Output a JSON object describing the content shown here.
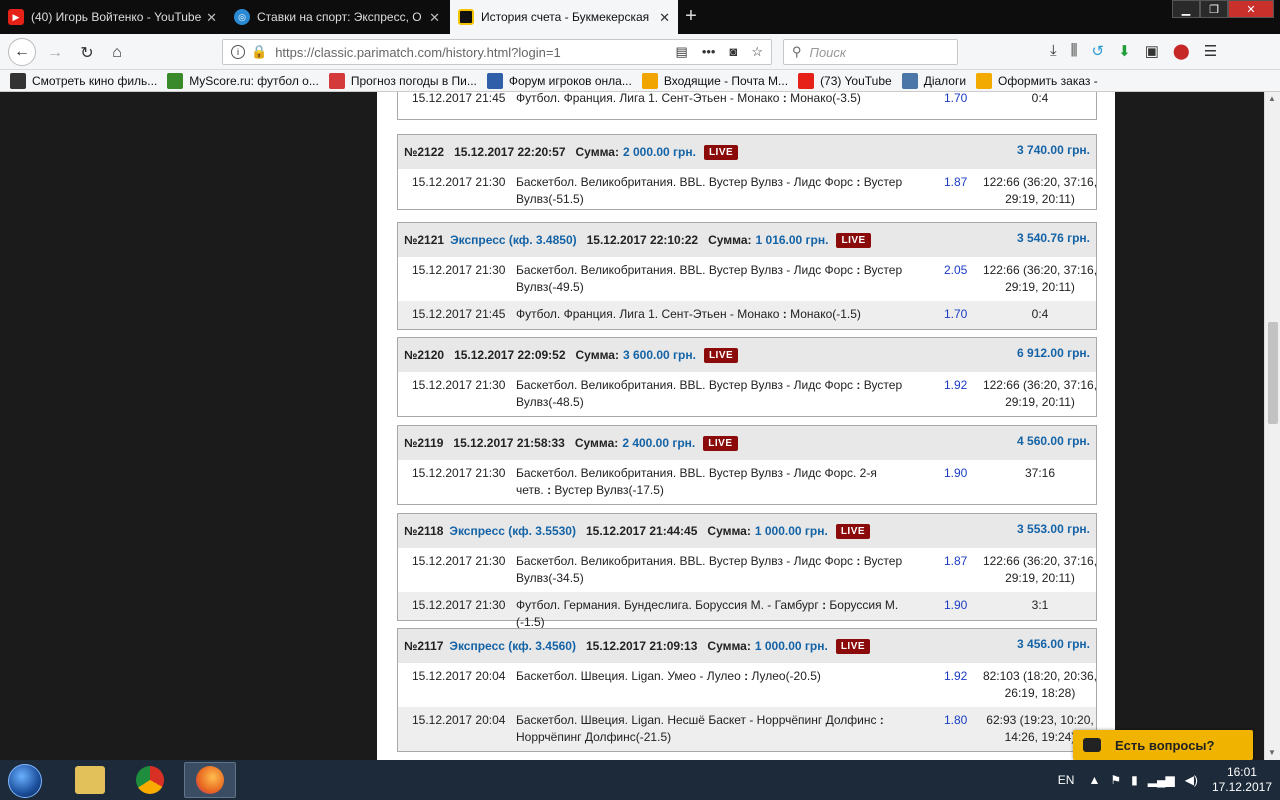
{
  "browser": {
    "tabs": [
      {
        "title": "(40) Игорь Войтенко - YouTube",
        "icon": "youtube-icon",
        "color": "#e62117",
        "active": false
      },
      {
        "title": "Ставки на спорт: Экспресс, О",
        "icon": "parimatch-favicon",
        "color": "#2a8ad4",
        "active": false
      },
      {
        "title": "История счета - Букмекерская",
        "icon": "parimatch-favicon",
        "color": "#f5c400",
        "active": true
      }
    ],
    "new_tab": "+",
    "url": "https://classic.parimatch.com/history.html?login=1",
    "search_placeholder": "Поиск",
    "bookmarks": [
      {
        "label": "Смотреть кино филь...",
        "icon": "kino-icon",
        "color": "#333333"
      },
      {
        "label": "MyScore.ru: футбол о...",
        "icon": "myscore-icon",
        "color": "#3a8a2b"
      },
      {
        "label": "Прогноз погоды в Пи...",
        "icon": "weather-icon",
        "color": "#d43a3a"
      },
      {
        "label": "Форум игроков онла...",
        "icon": "forum-icon",
        "color": "#2e5fa8"
      },
      {
        "label": "Входящие - Почта М...",
        "icon": "mail-icon",
        "color": "#f0a500"
      },
      {
        "label": "(73) YouTube",
        "icon": "youtube-icon",
        "color": "#e62117"
      },
      {
        "label": "Діалоги",
        "icon": "vk-icon",
        "color": "#4a76a8"
      },
      {
        "label": "Оформить заказ -",
        "icon": "order-icon",
        "color": "#f2a900"
      }
    ]
  },
  "history": {
    "partial_row": {
      "date": "15.12.2017 21:45",
      "event": "Футбол. Франция. Лига 1. Сент-Этьен - Монако",
      "sep": " : ",
      "pick": "Монако(-3.5)",
      "odds": "1.70",
      "score": "0:4"
    },
    "live_label": "LIVE",
    "sum_label": "Сумма:",
    "bets": [
      {
        "id": "№2122",
        "express": "",
        "datetime": "15.12.2017 22:20:57",
        "sum": "2 000.00 грн.",
        "win": "3 740.00 грн.",
        "rows": [
          {
            "date": "15.12.2017 21:30",
            "event": "Баскетбол. Великобритания. BBL. Вустер Вулвз - Лидс Форс",
            "sep": " : ",
            "pick": "Вустер Вулвз(-51.5)",
            "odds": "1.87",
            "score": "122:66 (36:20, 37:16, 29:19, 20:11)"
          }
        ]
      },
      {
        "id": "№2121",
        "express": "Экспресс (кф. 3.4850)",
        "datetime": "15.12.2017 22:10:22",
        "sum": "1 016.00 грн.",
        "win": "3 540.76 грн.",
        "rows": [
          {
            "date": "15.12.2017 21:30",
            "event": "Баскетбол. Великобритания. BBL. Вустер Вулвз - Лидс Форс",
            "sep": " : ",
            "pick": "Вустер Вулвз(-49.5)",
            "odds": "2.05",
            "score": "122:66 (36:20, 37:16, 29:19, 20:11)"
          },
          {
            "date": "15.12.2017 21:45",
            "event": "Футбол. Франция. Лига 1. Сент-Этьен - Монако",
            "sep": " : ",
            "pick": "Монако(-1.5)",
            "odds": "1.70",
            "score": "0:4"
          }
        ]
      },
      {
        "id": "№2120",
        "express": "",
        "datetime": "15.12.2017 22:09:52",
        "sum": "3 600.00 грн.",
        "win": "6 912.00 грн.",
        "rows": [
          {
            "date": "15.12.2017 21:30",
            "event": "Баскетбол. Великобритания. BBL. Вустер Вулвз - Лидс Форс",
            "sep": " : ",
            "pick": "Вустер Вулвз(-48.5)",
            "odds": "1.92",
            "score": "122:66 (36:20, 37:16, 29:19, 20:11)"
          }
        ]
      },
      {
        "id": "№2119",
        "express": "",
        "datetime": "15.12.2017 21:58:33",
        "sum": "2 400.00 грн.",
        "win": "4 560.00 грн.",
        "rows": [
          {
            "date": "15.12.2017 21:30",
            "event": "Баскетбол. Великобритания. BBL. Вустер Вулвз - Лидс Форс. 2-я четв.",
            "sep": " : ",
            "pick": "Вустер Вулвз(-17.5)",
            "odds": "1.90",
            "score": "37:16"
          }
        ]
      },
      {
        "id": "№2118",
        "express": "Экспресс (кф. 3.5530)",
        "datetime": "15.12.2017 21:44:45",
        "sum": "1 000.00 грн.",
        "win": "3 553.00 грн.",
        "rows": [
          {
            "date": "15.12.2017 21:30",
            "event": "Баскетбол. Великобритания. BBL. Вустер Вулвз - Лидс Форс",
            "sep": " : ",
            "pick": "Вустер Вулвз(-34.5)",
            "odds": "1.87",
            "score": "122:66 (36:20, 37:16, 29:19, 20:11)"
          },
          {
            "date": "15.12.2017 21:30",
            "event": "Футбол. Германия. Бундеслига. Боруссия М. - Гамбург",
            "sep": " : ",
            "pick": "Боруссия М.(-1.5)",
            "odds": "1.90",
            "score": "3:1"
          }
        ]
      },
      {
        "id": "№2117",
        "express": "Экспресс (кф. 3.4560)",
        "datetime": "15.12.2017 21:09:13",
        "sum": "1 000.00 грн.",
        "win": "3 456.00 грн.",
        "rows": [
          {
            "date": "15.12.2017 20:04",
            "event": "Баскетбол. Швеция. Ligan. Умео - Лулео",
            "sep": " : ",
            "pick": "Лулео(-20.5)",
            "odds": "1.92",
            "score": "82:103 (18:20, 20:36, 26:19, 18:28)"
          },
          {
            "date": "15.12.2017 20:04",
            "event": "Баскетбол. Швеция. Ligan. Несшё Баскет - Норрчёпинг Долфинс",
            "sep": " : ",
            "pick": "Норрчёпинг Долфинс(-21.5)",
            "odds": "1.80",
            "score": "62:93 (19:23, 10:20, 14:26, 19:24)"
          }
        ]
      }
    ]
  },
  "help_widget": "Есть вопросы?",
  "taskbar": {
    "apps": [
      {
        "name": "file-explorer-icon",
        "color": "#e2c15a"
      },
      {
        "name": "chrome-icon",
        "color": "#3a9a3a"
      },
      {
        "name": "firefox-icon",
        "color": "#e8671f"
      }
    ],
    "lang": "EN",
    "time": "16:01",
    "date": "17.12.2017"
  }
}
